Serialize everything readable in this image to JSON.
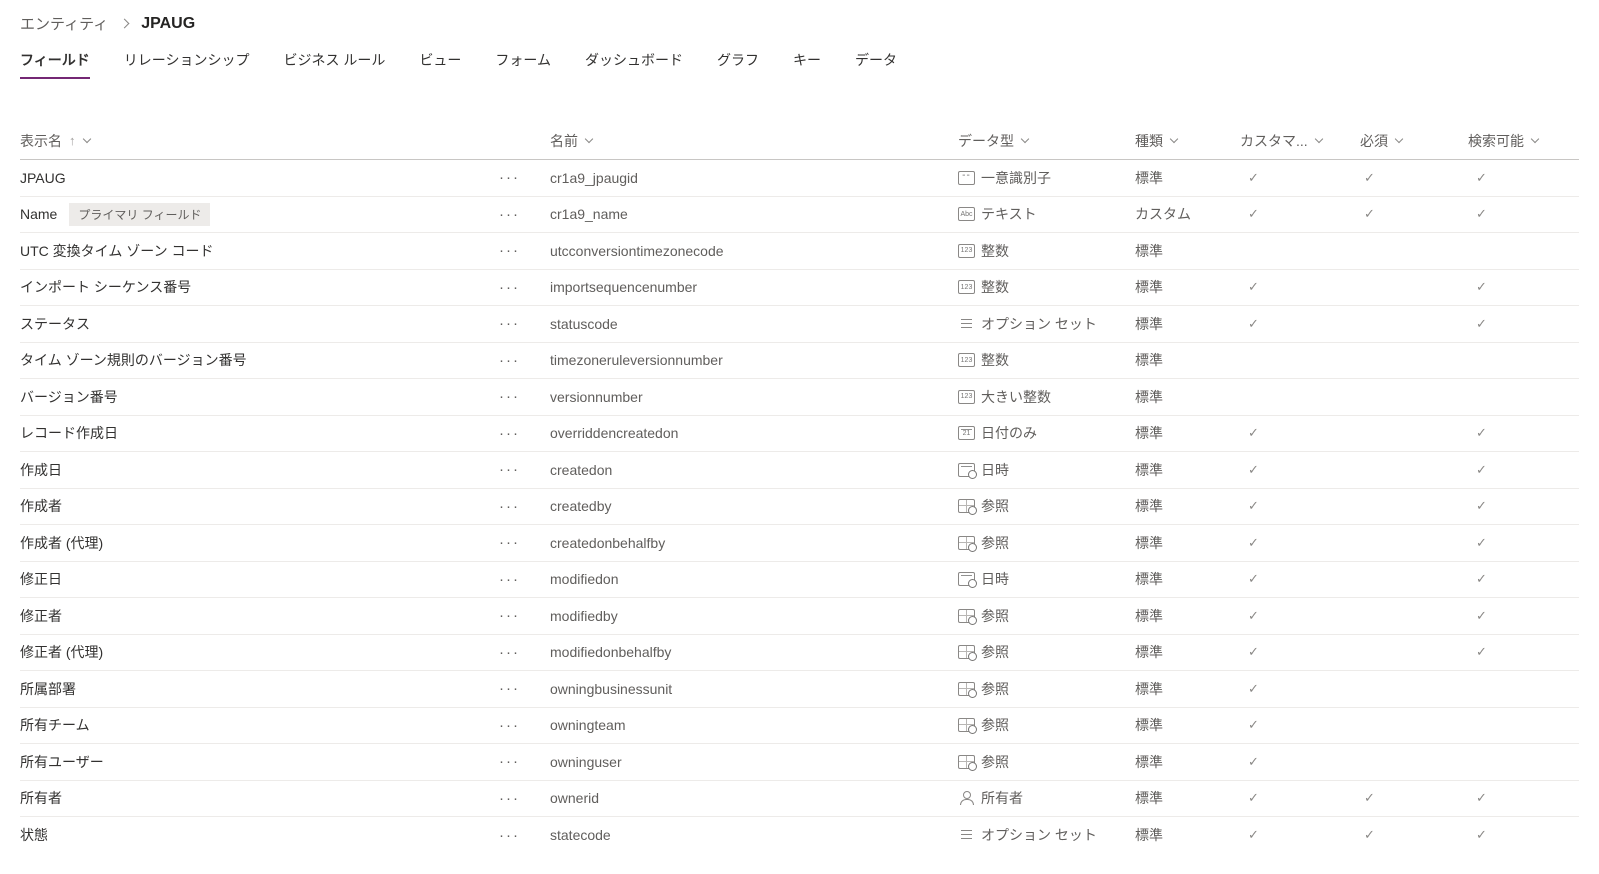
{
  "breadcrumb": {
    "parent": "エンティティ",
    "current": "JPAUG"
  },
  "tabs": [
    {
      "label": "フィールド",
      "active": true
    },
    {
      "label": "リレーションシップ",
      "active": false
    },
    {
      "label": "ビジネス ルール",
      "active": false
    },
    {
      "label": "ビュー",
      "active": false
    },
    {
      "label": "フォーム",
      "active": false
    },
    {
      "label": "ダッシュボード",
      "active": false
    },
    {
      "label": "グラフ",
      "active": false
    },
    {
      "label": "キー",
      "active": false
    },
    {
      "label": "データ",
      "active": false
    }
  ],
  "ui": {
    "more_glyph": "···",
    "check_glyph": "✓",
    "sort_asc_glyph": "↑"
  },
  "icon_glyphs": {
    "unique-id": "--",
    "text": "Abc",
    "number": "123",
    "date-only": "21",
    "datetime": "",
    "lookup": "",
    "owner": "",
    "option-set": ""
  },
  "table": {
    "columns": {
      "display_name": "表示名",
      "name": "名前",
      "data_type": "データ型",
      "kind": "種類",
      "customizable": "カスタマ...",
      "required": "必須",
      "searchable": "検索可能"
    },
    "sort": {
      "column": "display_name",
      "direction": "asc"
    },
    "rows": [
      {
        "display_name": "JPAUG",
        "badge": null,
        "name": "cr1a9_jpaugid",
        "data_type": {
          "icon": "unique-id",
          "label": "一意識別子"
        },
        "kind": "標準",
        "customizable": true,
        "required": true,
        "searchable": true
      },
      {
        "display_name": "Name",
        "badge": "プライマリ フィールド",
        "name": "cr1a9_name",
        "data_type": {
          "icon": "text",
          "label": "テキスト"
        },
        "kind": "カスタム",
        "customizable": true,
        "required": true,
        "searchable": true
      },
      {
        "display_name": "UTC 変換タイム ゾーン コード",
        "badge": null,
        "name": "utcconversiontimezonecode",
        "data_type": {
          "icon": "number",
          "label": "整数"
        },
        "kind": "標準",
        "customizable": false,
        "required": false,
        "searchable": false
      },
      {
        "display_name": "インポート シーケンス番号",
        "badge": null,
        "name": "importsequencenumber",
        "data_type": {
          "icon": "number",
          "label": "整数"
        },
        "kind": "標準",
        "customizable": true,
        "required": false,
        "searchable": true
      },
      {
        "display_name": "ステータス",
        "badge": null,
        "name": "statuscode",
        "data_type": {
          "icon": "option-set",
          "label": "オプション セット"
        },
        "kind": "標準",
        "customizable": true,
        "required": false,
        "searchable": true
      },
      {
        "display_name": "タイム ゾーン規則のバージョン番号",
        "badge": null,
        "name": "timezoneruleversionnumber",
        "data_type": {
          "icon": "number",
          "label": "整数"
        },
        "kind": "標準",
        "customizable": false,
        "required": false,
        "searchable": false
      },
      {
        "display_name": "バージョン番号",
        "badge": null,
        "name": "versionnumber",
        "data_type": {
          "icon": "number",
          "label": "大きい整数"
        },
        "kind": "標準",
        "customizable": false,
        "required": false,
        "searchable": false
      },
      {
        "display_name": "レコード作成日",
        "badge": null,
        "name": "overriddencreatedon",
        "data_type": {
          "icon": "date-only",
          "label": "日付のみ"
        },
        "kind": "標準",
        "customizable": true,
        "required": false,
        "searchable": true
      },
      {
        "display_name": "作成日",
        "badge": null,
        "name": "createdon",
        "data_type": {
          "icon": "datetime",
          "label": "日時"
        },
        "kind": "標準",
        "customizable": true,
        "required": false,
        "searchable": true
      },
      {
        "display_name": "作成者",
        "badge": null,
        "name": "createdby",
        "data_type": {
          "icon": "lookup",
          "label": "参照"
        },
        "kind": "標準",
        "customizable": true,
        "required": false,
        "searchable": true
      },
      {
        "display_name": "作成者 (代理)",
        "badge": null,
        "name": "createdonbehalfby",
        "data_type": {
          "icon": "lookup",
          "label": "参照"
        },
        "kind": "標準",
        "customizable": true,
        "required": false,
        "searchable": true
      },
      {
        "display_name": "修正日",
        "badge": null,
        "name": "modifiedon",
        "data_type": {
          "icon": "datetime",
          "label": "日時"
        },
        "kind": "標準",
        "customizable": true,
        "required": false,
        "searchable": true
      },
      {
        "display_name": "修正者",
        "badge": null,
        "name": "modifiedby",
        "data_type": {
          "icon": "lookup",
          "label": "参照"
        },
        "kind": "標準",
        "customizable": true,
        "required": false,
        "searchable": true
      },
      {
        "display_name": "修正者 (代理)",
        "badge": null,
        "name": "modifiedonbehalfby",
        "data_type": {
          "icon": "lookup",
          "label": "参照"
        },
        "kind": "標準",
        "customizable": true,
        "required": false,
        "searchable": true
      },
      {
        "display_name": "所属部署",
        "badge": null,
        "name": "owningbusinessunit",
        "data_type": {
          "icon": "lookup",
          "label": "参照"
        },
        "kind": "標準",
        "customizable": true,
        "required": false,
        "searchable": false
      },
      {
        "display_name": "所有チーム",
        "badge": null,
        "name": "owningteam",
        "data_type": {
          "icon": "lookup",
          "label": "参照"
        },
        "kind": "標準",
        "customizable": true,
        "required": false,
        "searchable": false
      },
      {
        "display_name": "所有ユーザー",
        "badge": null,
        "name": "owninguser",
        "data_type": {
          "icon": "lookup",
          "label": "参照"
        },
        "kind": "標準",
        "customizable": true,
        "required": false,
        "searchable": false
      },
      {
        "display_name": "所有者",
        "badge": null,
        "name": "ownerid",
        "data_type": {
          "icon": "owner",
          "label": "所有者"
        },
        "kind": "標準",
        "customizable": true,
        "required": true,
        "searchable": true
      },
      {
        "display_name": "状態",
        "badge": null,
        "name": "statecode",
        "data_type": {
          "icon": "option-set",
          "label": "オプション セット"
        },
        "kind": "標準",
        "customizable": true,
        "required": true,
        "searchable": true
      }
    ]
  }
}
